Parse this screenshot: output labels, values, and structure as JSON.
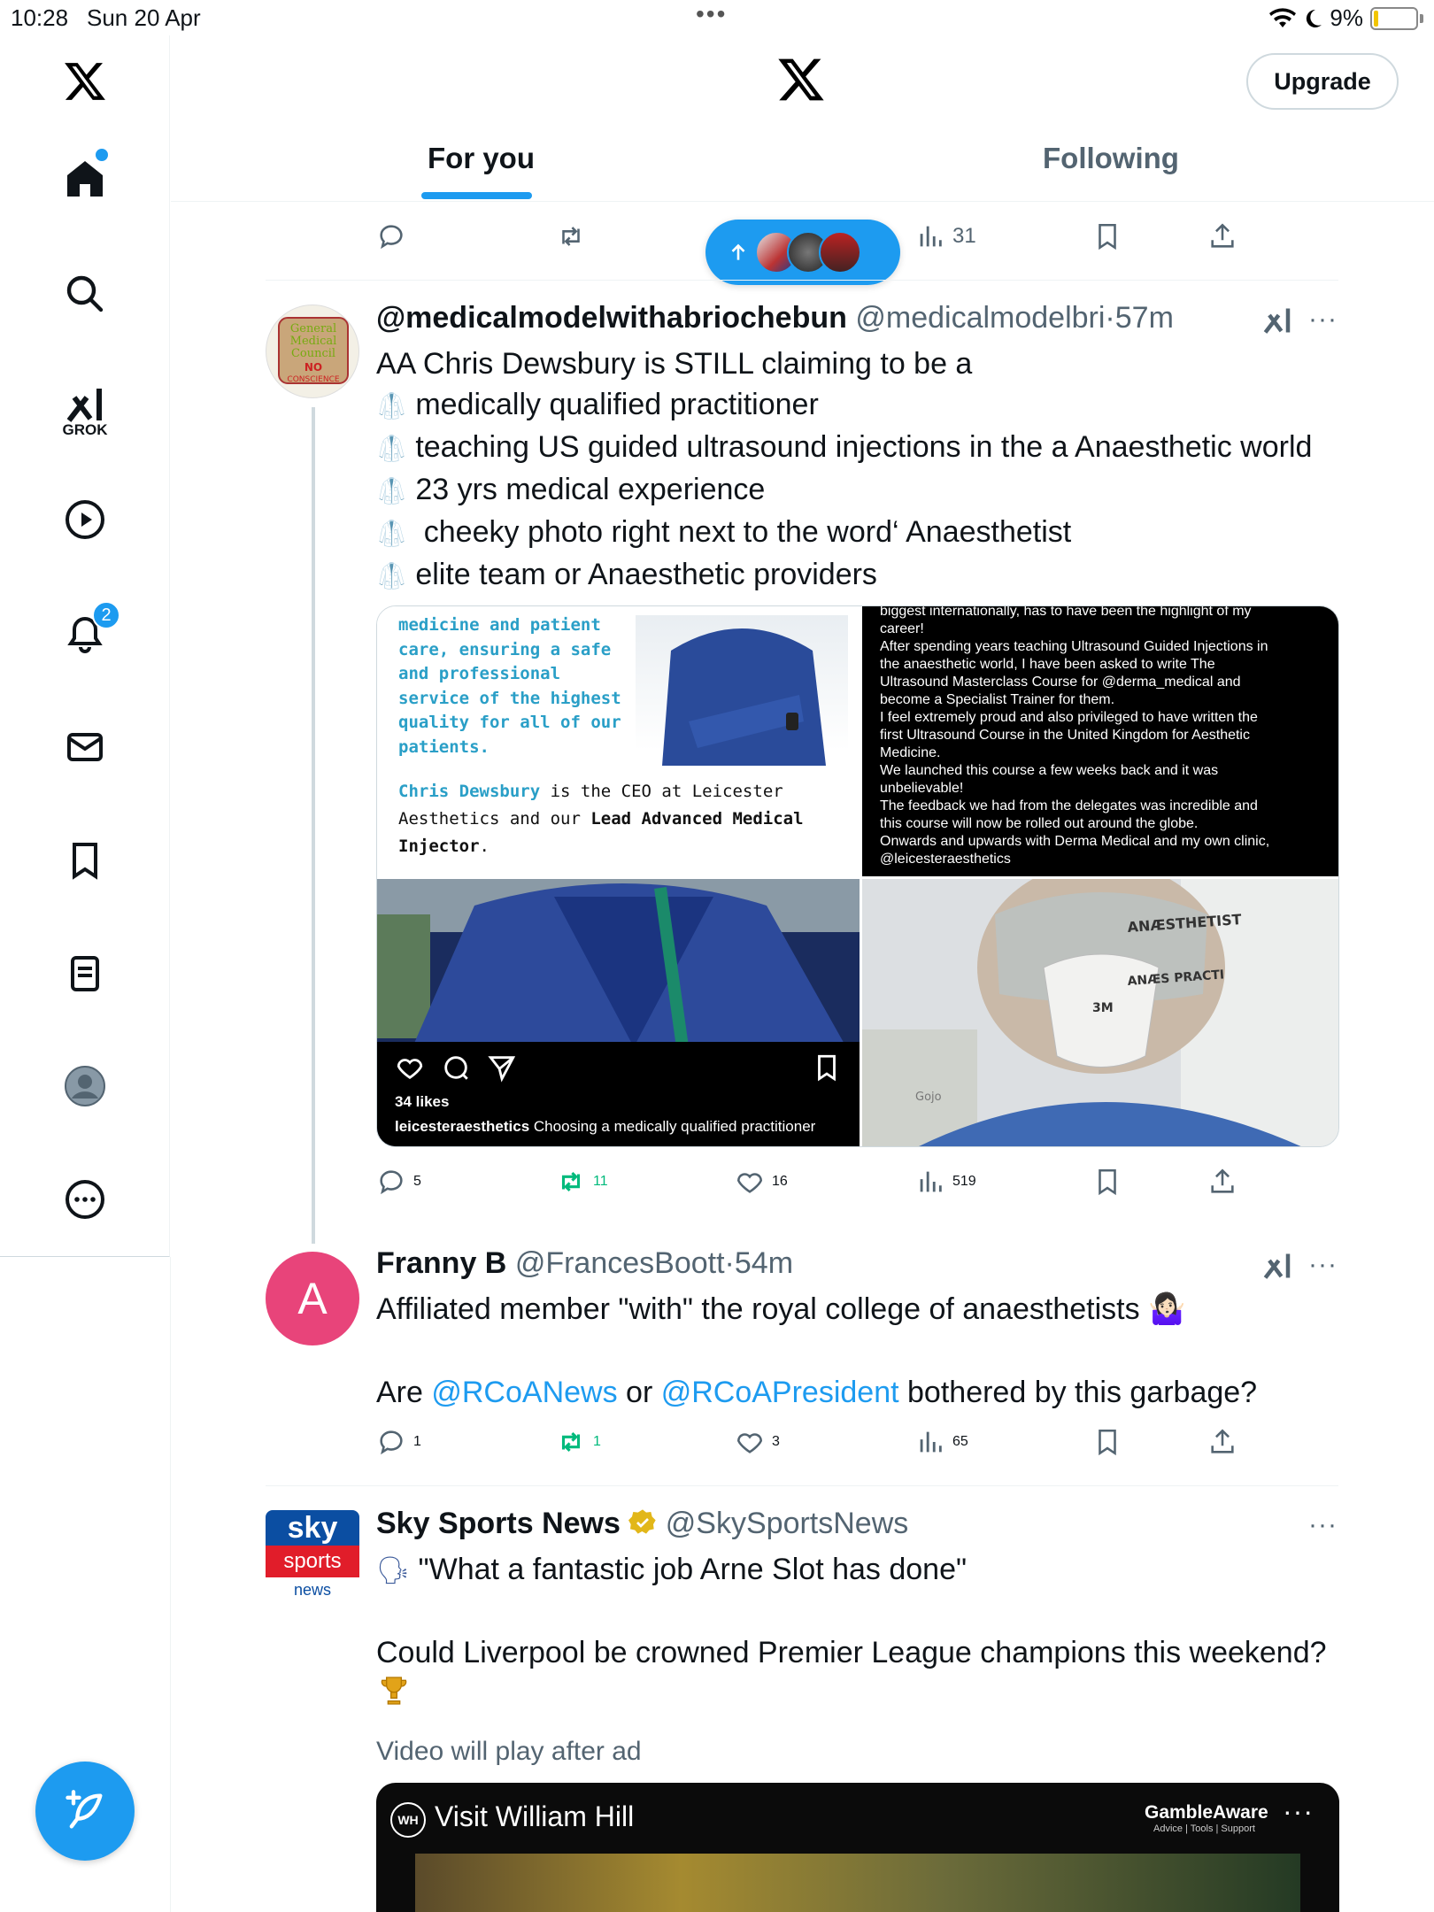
{
  "status_bar": {
    "time": "10:28",
    "date": "Sun 20 Apr",
    "battery": "9%"
  },
  "sidebar": {
    "grok_label": "GROK",
    "notifications_badge": "2"
  },
  "header": {
    "upgrade_label": "Upgrade",
    "tabs": [
      {
        "label": "For you",
        "active": true
      },
      {
        "label": "Following",
        "active": false
      }
    ]
  },
  "top_actions": {
    "views": "31"
  },
  "posts": [
    {
      "display_name": "@medicalmodelwithabriochebun",
      "handle": "@medicalmodelbri",
      "time": "57m",
      "lines": [
        "AA Chris Dewsbury is STILL claiming to be a",
        "medically qualified practitioner",
        "teaching US guided ultrasound injections in the a Anaesthetic world",
        "23 yrs medical experience",
        " cheeky photo right next to the word‘ Anaesthetist",
        "elite team or Anaesthetic providers"
      ],
      "avatar_text": [
        "General",
        "Medical",
        "Council",
        "NO",
        "CONSCIENCE"
      ],
      "media": {
        "card1_lines": [
          "medicine and patient",
          "care, ensuring a safe",
          "and professional",
          "service of the highest",
          "quality for all of our",
          "patients."
        ],
        "card1_name": "Chris Dewsbury",
        "card1_rest1": " is the CEO at Leicester",
        "card1_rest2": "Aesthetics and our ",
        "card1_bold": "Lead Advanced Medical Injector",
        "card1_end": ".",
        "card2_text": [
          "biggest internationally, has to have been the highlight of my",
          "career!",
          "After spending years teaching Ultrasound Guided Injections in",
          "the anaesthetic world, I have been asked to write The",
          "Ultrasound Masterclass Course for @derma_medical and",
          "become a Specialist Trainer for them.",
          "I feel extremely proud and also privileged to have written the",
          "first Ultrasound Course in the United Kingdom for Aesthetic",
          "Medicine.",
          "We launched this course a few weeks back and it was",
          "unbelievable!",
          "The feedback we had from the delegates was incredible and",
          "this course will now be rolled out around the globe.",
          "Onwards and upwards with Derma Medical and my own clinic,",
          "@leicesteraesthetics"
        ],
        "card3_likes": "34 likes",
        "card3_user": "leicesteraesthetics",
        "card3_caption": " Choosing a medically qualified practitioner",
        "card4_sign1": "ANÆSTHETIST",
        "card4_sign2": "ANÆS PRACTI",
        "card4_mask": "3M",
        "card4_brand": "Gojo"
      },
      "stats": {
        "replies": "5",
        "reposts": "11",
        "likes": "16",
        "views": "519"
      }
    },
    {
      "display_name": "Franny B",
      "handle": "@FrancesBoott",
      "time": "54m",
      "avatar_letter": "A",
      "line1": "Affiliated member \"with\" the royal college of anaesthetists 🤷🏻‍♀️",
      "line2_pre": "Are ",
      "mention1": "@RCoANews",
      "line2_mid": " or ",
      "mention2": "@RCoAPresident",
      "line2_post": " bothered by this garbage?",
      "stats": {
        "replies": "1",
        "reposts": "1",
        "likes": "3",
        "views": "65"
      }
    },
    {
      "display_name": "Sky Sports News",
      "handle": "@SkySportsNews",
      "avatar_lines": [
        "sky",
        "sports",
        "news"
      ],
      "line1": "\"What a fantastic job Arne Slot has done\"",
      "line2": "Could Liverpool be crowned Premier League champions this weekend?",
      "video_note": "Video will play after ad",
      "ad_title": "Visit William Hill",
      "ad_brand": "GambleAware",
      "ad_brand_sub": "Advice | Tools | Support"
    }
  ],
  "colors": {
    "accent": "#1d9bf0",
    "repost_green": "#00ba7c",
    "text": "#0f1419",
    "secondary": "#536471"
  }
}
